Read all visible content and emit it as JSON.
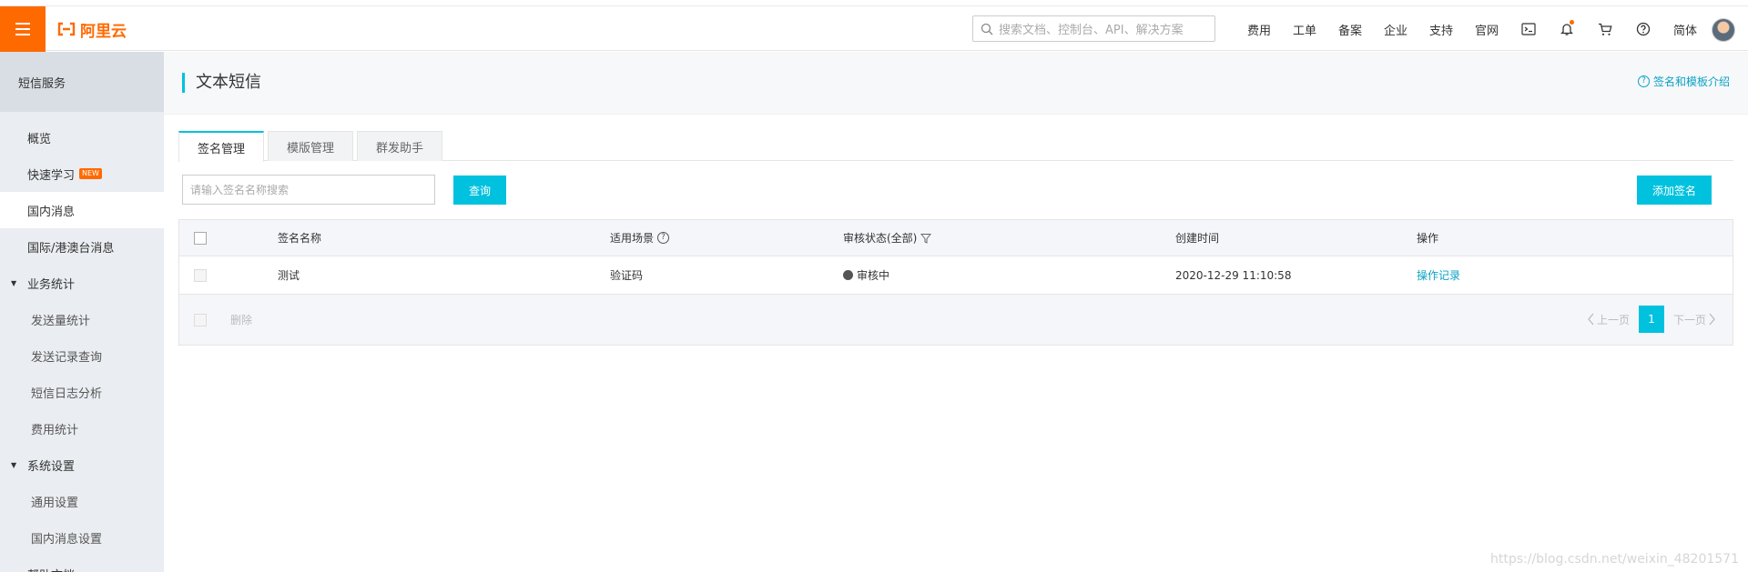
{
  "brand": {
    "logo_text": "阿里云",
    "accent": "#ff6a00",
    "primary": "#00c1de"
  },
  "search": {
    "placeholder": "搜索文档、控制台、API、解决方案"
  },
  "topnav": {
    "links": [
      "费用",
      "工单",
      "备案",
      "企业",
      "支持",
      "官网"
    ],
    "icons": [
      "terminal-icon",
      "bell-icon",
      "cart-icon",
      "help-icon"
    ],
    "lang": "简体"
  },
  "sidebar": {
    "header": "短信服务",
    "items": [
      {
        "label": "概览"
      },
      {
        "label": "快速学习",
        "badge": "NEW"
      },
      {
        "label": "国内消息"
      },
      {
        "label": "国际/港澳台消息"
      }
    ],
    "group1": {
      "label": "业务统计",
      "items": [
        "发送量统计",
        "发送记录查询",
        "短信日志分析",
        "费用统计"
      ]
    },
    "group2": {
      "label": "系统设置",
      "items": [
        "通用设置",
        "国内消息设置"
      ]
    },
    "more": "帮助文档"
  },
  "page": {
    "title": "文本短信",
    "help_link": "签名和模板介绍",
    "tabs": [
      "签名管理",
      "模版管理",
      "群发助手"
    ],
    "filter_placeholder": "请输入签名名称搜索",
    "query_button": "查询",
    "add_button": "添加签名"
  },
  "table": {
    "columns": [
      "签名名称",
      "适用场景",
      "审核状态(全部)",
      "创建时间",
      "操作"
    ],
    "rows": [
      {
        "name": "测试",
        "scene": "验证码",
        "status": "审核中",
        "created": "2020-12-29 11:10:58",
        "action": "操作记录"
      }
    ],
    "delete_label": "删除",
    "pager": {
      "prev": "上一页",
      "current": "1",
      "next": "下一页"
    }
  },
  "watermark": "https://blog.csdn.net/weixin_48201571"
}
